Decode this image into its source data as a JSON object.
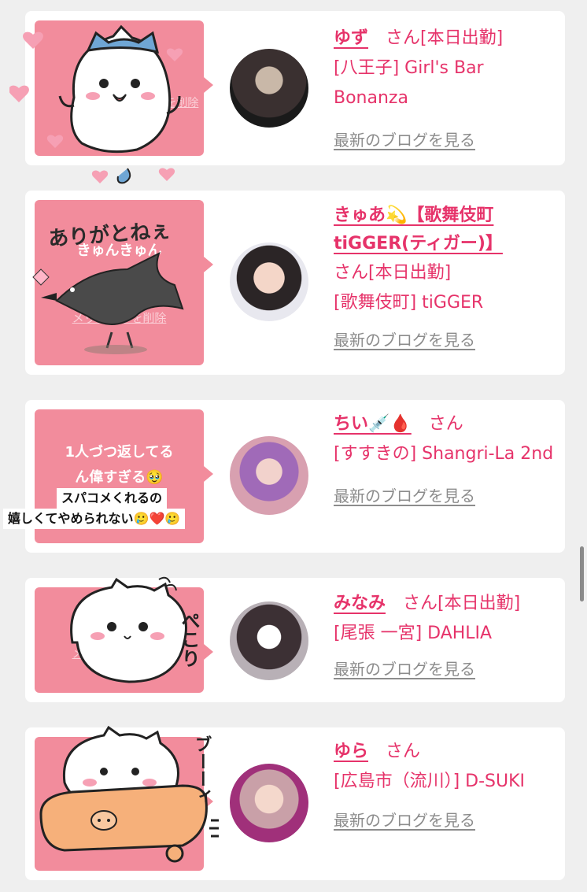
{
  "blog_link_label": "最新のブログを見る",
  "message_link_label": "メッセージを削除",
  "entries": [
    {
      "name": "ゆず",
      "suffix": "さん",
      "status": "[本日出勤]",
      "location_shop": "[八王子] Girl's Bar Bonanza",
      "bubble_text": ""
    },
    {
      "name": "きゅあ💫【歌舞伎町tiGGER(ティガー)】",
      "suffix": "さん",
      "status": "[本日出勤]",
      "location_shop": "[歌舞伎町] tiGGER",
      "sticker_text_1": "ありがとねぇ",
      "sticker_text_2": "きゅんきゅん"
    },
    {
      "name": "ちい💉🩸",
      "suffix": "さん",
      "status": "",
      "location_shop": "[すすきの] Shangri-La 2nd",
      "bubble_text_1": "1人づつ返してる",
      "bubble_text_2": "ん偉すぎる🥹",
      "caption_1": "スパコメくれるの",
      "caption_2": "嬉しくてやめられない🥲❤️🥲"
    },
    {
      "name": "みなみ",
      "suffix": "さん",
      "status": "[本日出勤]",
      "location_shop": "[尾張 一宮] DAHLIA",
      "sticker_text_1": "ぺこり"
    },
    {
      "name": "ゆら",
      "suffix": "さん",
      "status": "",
      "location_shop": "[広島市（流川）] D-SUKI",
      "sticker_text_1": "ブーーィ"
    }
  ],
  "colors": {
    "accent": "#e6336a",
    "bubble": "#f28c9c",
    "link_gray": "#8c8c8c",
    "background": "#efefef"
  }
}
